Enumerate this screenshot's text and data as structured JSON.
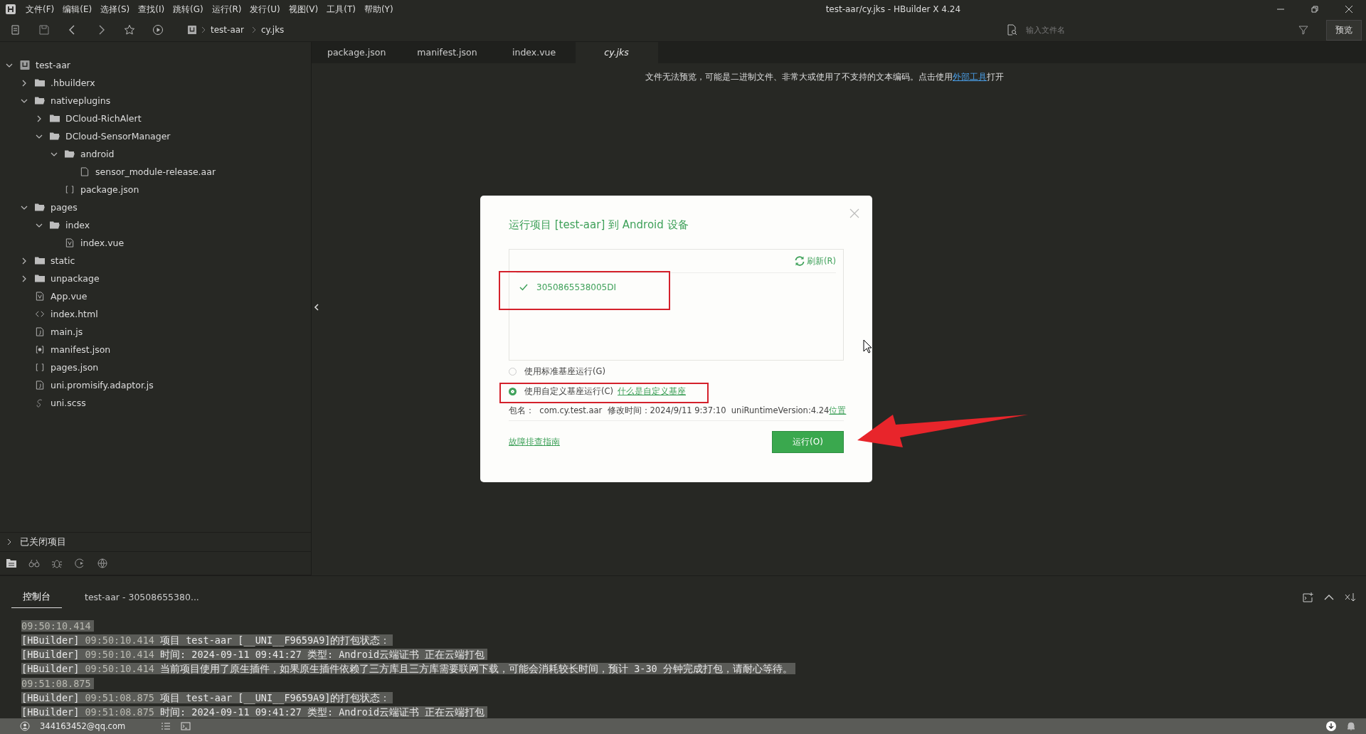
{
  "window": {
    "title": "test-aar/cy.jks - HBuilder X 4.24"
  },
  "menu": [
    "文件(F)",
    "编辑(E)",
    "选择(S)",
    "查找(I)",
    "跳转(G)",
    "运行(R)",
    "发行(U)",
    "视图(V)",
    "工具(T)",
    "帮助(Y)"
  ],
  "breadcrumb": [
    "test-aar",
    "cy.jks"
  ],
  "file_search": {
    "placeholder": "输入文件名"
  },
  "preview_button": "预览",
  "project_tree": [
    {
      "name": "test-aar",
      "kind": "project",
      "expanded": true,
      "children": [
        {
          "name": ".hbuilderx",
          "kind": "folder",
          "expanded": false
        },
        {
          "name": "nativeplugins",
          "kind": "folder",
          "expanded": true,
          "children": [
            {
              "name": "DCloud-RichAlert",
              "kind": "folder",
              "expanded": false
            },
            {
              "name": "DCloud-SensorManager",
              "kind": "folder",
              "expanded": true,
              "children": [
                {
                  "name": "android",
                  "kind": "folder",
                  "expanded": true,
                  "children": [
                    {
                      "name": "sensor_module-release.aar",
                      "kind": "file"
                    }
                  ]
                },
                {
                  "name": "package.json",
                  "kind": "json"
                }
              ]
            }
          ]
        },
        {
          "name": "pages",
          "kind": "folder",
          "expanded": true,
          "children": [
            {
              "name": "index",
              "kind": "folder",
              "expanded": true,
              "children": [
                {
                  "name": "index.vue",
                  "kind": "vue"
                }
              ]
            }
          ]
        },
        {
          "name": "static",
          "kind": "folder",
          "expanded": false
        },
        {
          "name": "unpackage",
          "kind": "folder",
          "expanded": false
        },
        {
          "name": "App.vue",
          "kind": "vue"
        },
        {
          "name": "index.html",
          "kind": "html"
        },
        {
          "name": "main.js",
          "kind": "js"
        },
        {
          "name": "manifest.json",
          "kind": "manifest"
        },
        {
          "name": "pages.json",
          "kind": "json"
        },
        {
          "name": "uni.promisify.adaptor.js",
          "kind": "js"
        },
        {
          "name": "uni.scss",
          "kind": "scss"
        }
      ]
    }
  ],
  "closed_projects": {
    "label": "已关闭项目",
    "expanded": false
  },
  "editor_tabs": [
    {
      "label": "package.json",
      "selected": false
    },
    {
      "label": "manifest.json",
      "selected": false
    },
    {
      "label": "index.vue",
      "selected": false
    },
    {
      "label": "cy.jks",
      "selected": true
    }
  ],
  "editor_message": {
    "text": "文件无法预览，可能是二进制文件、非常大或使用了不支持的文本编码。点击使用",
    "link": "外部工具",
    "after": "打开"
  },
  "dialog": {
    "title": "运行项目 [test-aar] 到 Android 设备",
    "refresh": "刷新(R)",
    "devices": [
      {
        "id": "3050865538005DI",
        "checked": true
      }
    ],
    "options": [
      {
        "label": "使用标准基座运行(G)",
        "selected": false
      },
      {
        "label": "使用自定义基座运行(C)",
        "selected": true,
        "link": "什么是自定义基座"
      }
    ],
    "info": "包名：  com.cy.test.aar  修改时间：2024/9/11 9:37:10  uniRuntimeVersion:4.24",
    "info_link": "位置",
    "help_link": "故障排查指南",
    "run_button": "运行(O)"
  },
  "console_tabs": [
    {
      "label": "控制台",
      "selected": true
    },
    {
      "label": "test-aar - 30508655380...",
      "selected": false
    }
  ],
  "console_lines": [
    {
      "kind": "time",
      "time": "09:50:10.414"
    },
    {
      "kind": "log",
      "source": "[HBuilder]",
      "time": "09:50:10.414",
      "message": "项目 test-aar [__UNI__F9659A9]的打包状态："
    },
    {
      "kind": "log",
      "source": "[HBuilder]",
      "time": "09:50:10.414",
      "message": "时间: 2024-09-11 09:41:27    类型: Android云端证书    正在云端打包"
    },
    {
      "kind": "log",
      "source": "[HBuilder]",
      "time": "09:50:10.414",
      "message": "当前项目使用了原生插件，如果原生插件依赖了三方库且三方库需要联网下载，可能会消耗较长时间，预计 3-30 分钟完成打包，请耐心等待。"
    },
    {
      "kind": "time",
      "time": "09:51:08.875"
    },
    {
      "kind": "log",
      "source": "[HBuilder]",
      "time": "09:51:08.875",
      "message": "项目 test-aar [__UNI__F9659A9]的打包状态："
    },
    {
      "kind": "log",
      "source": "[HBuilder]",
      "time": "09:51:08.875",
      "message": "时间: 2024-09-11 09:41:27    类型: Android云端证书    正在云端打包"
    }
  ],
  "status_bar": {
    "user": "344163452@qq.com"
  }
}
